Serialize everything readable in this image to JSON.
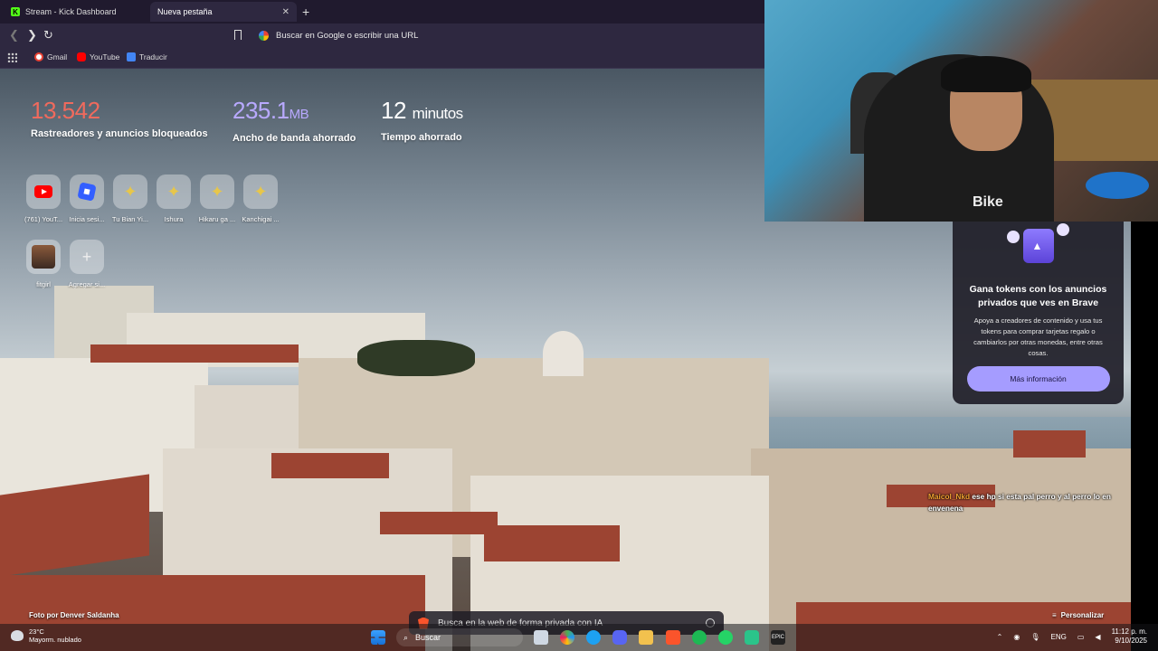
{
  "browser": {
    "tabs": [
      {
        "label": "Stream - Kick Dashboard",
        "active": false
      },
      {
        "label": "Nueva pestaña",
        "active": true
      }
    ],
    "urlbar_placeholder": "Buscar en Google o escribir una URL",
    "bookmarks": [
      {
        "label": "Gmail",
        "icon": "gmail-icon"
      },
      {
        "label": "YouTube",
        "icon": "youtube-icon"
      },
      {
        "label": "Traducir",
        "icon": "translate-icon"
      }
    ]
  },
  "stats": {
    "trackers": {
      "value": "13.542",
      "label": "Rastreadores y anuncios bloqueados",
      "color": "#f06a5d"
    },
    "bandwidth": {
      "value": "235.1",
      "unit": "MB",
      "label": "Ancho de banda ahorrado",
      "color": "#b8a9ff"
    },
    "time": {
      "value": "12",
      "unit": "minutos",
      "label": "Tiempo ahorrado",
      "color": "#ffffff"
    }
  },
  "top_sites": [
    {
      "label": "(761) YouT...",
      "icon": "youtube-icon"
    },
    {
      "label": "Inicia sesi...",
      "icon": "roblox-icon"
    },
    {
      "label": "Tu Bian Yi...",
      "icon": "star-icon"
    },
    {
      "label": "Ishura",
      "icon": "star-icon"
    },
    {
      "label": "Hikaru ga ...",
      "icon": "star-icon"
    },
    {
      "label": "Kanchigai ...",
      "icon": "star-icon"
    },
    {
      "label": "fitgirl",
      "icon": "avatar-icon"
    },
    {
      "label": "Agregar si...",
      "icon": "plus-icon"
    }
  ],
  "ad_card": {
    "title": "Gana tokens con los anuncios privados que ves en Brave",
    "body": "Apoya a creadores de contenido y usa tus tokens para comprar tarjetas regalo o cambiarlos por otras monedas, entre otras cosas.",
    "button": "Más información"
  },
  "chat": {
    "user": "Maicol_Nkd",
    "message": "ese hp si esta pal perro y al perro lo en envenena"
  },
  "footer": {
    "photo_credit": "Foto por Denver Saldanha",
    "search_placeholder": "Busca en la web de forma privada con IA",
    "customize": "Personalizar"
  },
  "taskbar": {
    "weather_temp": "23°C",
    "weather_desc": "Mayorm. nublado",
    "search_label": "Buscar",
    "language": "ENG",
    "time": "11:12 p. m.",
    "date": "9/10/2025"
  }
}
